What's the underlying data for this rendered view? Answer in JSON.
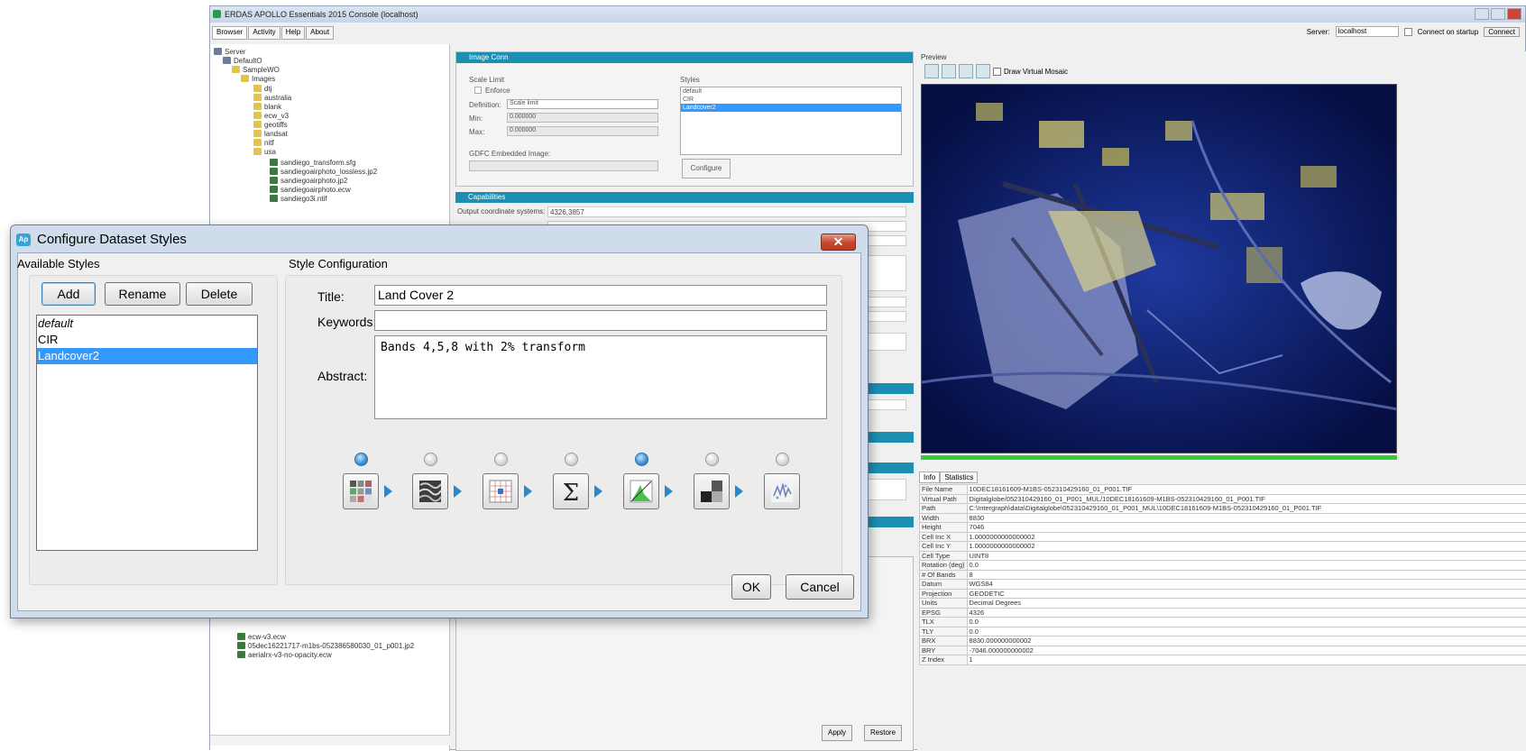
{
  "background_window": {
    "title": "ERDAS APOLLO Essentials 2015 Console (localhost)",
    "tabs": [
      "Browser",
      "Activity",
      "Help",
      "About"
    ],
    "server_label": "Server:",
    "server_value": "localhost",
    "connect_on_startup_label": "Connect on startup",
    "connect_label": "Connect",
    "tree": [
      {
        "label": "Server",
        "depth": 0,
        "icon": "server-icon"
      },
      {
        "label": "DefaultO",
        "depth": 1,
        "icon": "globe-icon"
      },
      {
        "label": "SampleWO",
        "depth": 2,
        "icon": "folder-icon"
      },
      {
        "label": "Images",
        "depth": 3,
        "icon": "folder-icon"
      },
      {
        "label": "dtj",
        "depth": 4,
        "icon": "folder-icon"
      },
      {
        "label": "australia",
        "depth": 4,
        "icon": "folder-icon"
      },
      {
        "label": "blank",
        "depth": 4,
        "icon": "folder-icon"
      },
      {
        "label": "ecw_v3",
        "depth": 4,
        "icon": "folder-icon"
      },
      {
        "label": "geotiffs",
        "depth": 4,
        "icon": "folder-icon"
      },
      {
        "label": "landsat",
        "depth": 4,
        "icon": "folder-icon"
      },
      {
        "label": "nitf",
        "depth": 4,
        "icon": "folder-icon"
      },
      {
        "label": "usa",
        "depth": 4,
        "icon": "folder-icon"
      },
      {
        "label": "sandiego_transform.sfg",
        "depth": 5,
        "icon": "file-icon"
      },
      {
        "label": "sandiegoairphoto_lossless.jp2",
        "depth": 5,
        "icon": "file-icon"
      },
      {
        "label": "sandiegoairphoto.jp2",
        "depth": 5,
        "icon": "file-icon"
      },
      {
        "label": "sandiegoairphoto.ecw",
        "depth": 5,
        "icon": "file-icon"
      },
      {
        "label": "sandiego3i.ntif",
        "depth": 5,
        "icon": "file-icon"
      }
    ],
    "tree_bottom": [
      "ecw-v3.ecw",
      "05dec16221717-m1bs-052386580030_01_p001.jp2",
      "aerialrx-v3-no-opacity.ecw"
    ],
    "image_conn_title": "Image Conn",
    "scale_limit_label": "Scale Limit",
    "enforce_label": "Enforce",
    "definition_label": "Definition:",
    "definition_value": "Scale limit",
    "min_label": "Min:",
    "min_value": "0.000000",
    "max_label": "Max:",
    "max_value": "0.000000",
    "gdfc_label": "GDFC Embedded Image:",
    "styles_label": "Styles",
    "styles_items": [
      "default",
      "CIR",
      "Landcover2"
    ],
    "configure_label": "Configure",
    "capabilities_title": "Capabilities",
    "output_crs_label": "Output coordinate systems:",
    "output_crs_value": "4326,3857",
    "apply_label": "Apply",
    "restore_label": "Restore",
    "preview_label": "Preview",
    "draw_virtual_mosaic_label": "Draw Virtual Mosaic",
    "info_tabs": [
      "Info",
      "Statistics"
    ],
    "info_rows": [
      {
        "key": "File Name",
        "value": "10DEC18161609-M1BS-052310429160_01_P001.TIF"
      },
      {
        "key": "Virtual Path",
        "value": "Digitalglobe/052310429160_01_P001_MUL/10DEC18161609-M1BS-052310429160_01_P001.TIF"
      },
      {
        "key": "Path",
        "value": "C:\\Intergraph\\data\\Digitalglobe\\052310429160_01_P001_MUL\\10DEC18161609-M1BS-052310429160_01_P001.TIF"
      },
      {
        "key": "Width",
        "value": "8830"
      },
      {
        "key": "Height",
        "value": "7046"
      },
      {
        "key": "Cell Inc X",
        "value": "1.0000000000000002"
      },
      {
        "key": "Cell Inc Y",
        "value": "1.0000000000000002"
      },
      {
        "key": "Cell Type",
        "value": "UINT8"
      },
      {
        "key": "Rotation (deg)",
        "value": "0.0"
      },
      {
        "key": "# Of Bands",
        "value": "8"
      },
      {
        "key": "Datum",
        "value": "WGS84"
      },
      {
        "key": "Projection",
        "value": "GEODETIC"
      },
      {
        "key": "Units",
        "value": "Decimal Degrees"
      },
      {
        "key": "EPSG",
        "value": "4326"
      },
      {
        "key": "TLX",
        "value": "0.0"
      },
      {
        "key": "TLY",
        "value": "0.0"
      },
      {
        "key": "BRX",
        "value": "8830.000000000002"
      },
      {
        "key": "BRY",
        "value": "-7046.000000000002"
      },
      {
        "key": "Z Index",
        "value": "1"
      }
    ]
  },
  "dialog": {
    "title": "Configure Dataset Styles",
    "app_icon_text": "Ap",
    "close_label": "✕",
    "available_styles": {
      "title": "Available Styles",
      "add_label": "Add",
      "rename_label": "Rename",
      "delete_label": "Delete",
      "items": [
        {
          "label": "default",
          "italic": true,
          "selected": false
        },
        {
          "label": "CIR",
          "italic": false,
          "selected": false
        },
        {
          "label": "Landcover2",
          "italic": false,
          "selected": true
        }
      ]
    },
    "style_config": {
      "title": "Style Configuration",
      "title_label": "Title:",
      "title_value": "Land Cover 2",
      "keywords_label": "Keywords:",
      "keywords_value": "",
      "abstract_label": "Abstract:",
      "abstract_value": "Bands 4,5,8 with 2% transform",
      "pipeline": [
        {
          "name": "band-selection-icon",
          "active": true
        },
        {
          "name": "texture-filter-icon",
          "active": false
        },
        {
          "name": "grid-cell-icon",
          "active": false
        },
        {
          "name": "sigma-sum-icon",
          "active": false
        },
        {
          "name": "histogram-stretch-icon",
          "active": true
        },
        {
          "name": "contrast-blocks-icon",
          "active": false
        },
        {
          "name": "sharpen-noise-icon",
          "active": false
        }
      ]
    },
    "ok_label": "OK",
    "cancel_label": "Cancel"
  },
  "colors": {
    "section_header": "#1c8fb3",
    "selection": "#3399ff",
    "active_step": "#3b8fd4",
    "progress": "#35c93d"
  }
}
